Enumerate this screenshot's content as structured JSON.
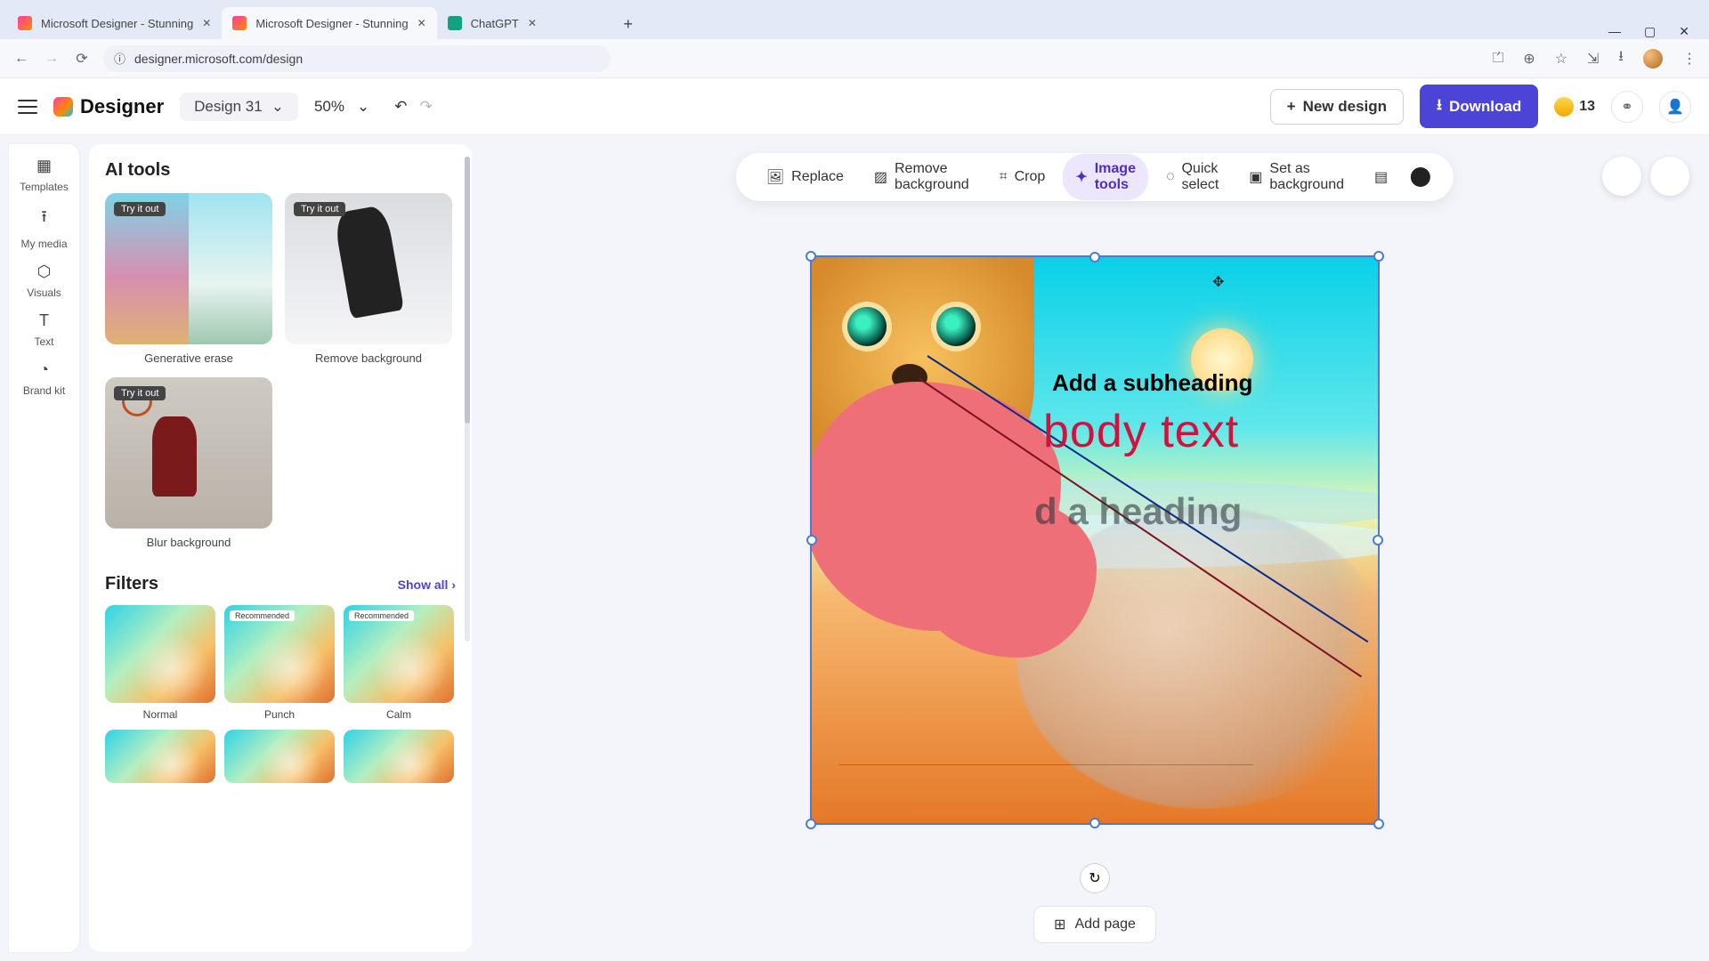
{
  "browser": {
    "tabs": [
      {
        "title": "Microsoft Designer - Stunning",
        "favicon": "#ff3da5"
      },
      {
        "title": "Microsoft Designer - Stunning",
        "favicon": "#ff3da5"
      },
      {
        "title": "ChatGPT",
        "favicon": "#10a37f"
      }
    ],
    "url": "designer.microsoft.com/design"
  },
  "header": {
    "app_name": "Designer",
    "design_title": "Design 31",
    "zoom": "50%",
    "new_design": "New design",
    "download": "Download",
    "coins": "13"
  },
  "rail": {
    "items": [
      {
        "label": "Templates"
      },
      {
        "label": "My media"
      },
      {
        "label": "Visuals"
      },
      {
        "label": "Text"
      },
      {
        "label": "Brand kit"
      }
    ]
  },
  "panel": {
    "ai_title": "AI tools",
    "try_badge": "Try it out",
    "ai_cards": [
      {
        "label": "Generative erase"
      },
      {
        "label": "Remove background"
      },
      {
        "label": "Blur background"
      }
    ],
    "filters_title": "Filters",
    "show_all": "Show all",
    "recommended": "Recommended",
    "filters": [
      {
        "label": "Normal"
      },
      {
        "label": "Punch"
      },
      {
        "label": "Calm"
      }
    ]
  },
  "context_bar": {
    "replace": "Replace",
    "remove_bg": "Remove background",
    "crop": "Crop",
    "image_tools": "Image tools",
    "quick_select": "Quick select",
    "set_bg": "Set as background"
  },
  "canvas": {
    "subheading": "Add a subheading",
    "body_text": "body text",
    "heading": "d a heading"
  },
  "footer": {
    "add_page": "Add page"
  }
}
